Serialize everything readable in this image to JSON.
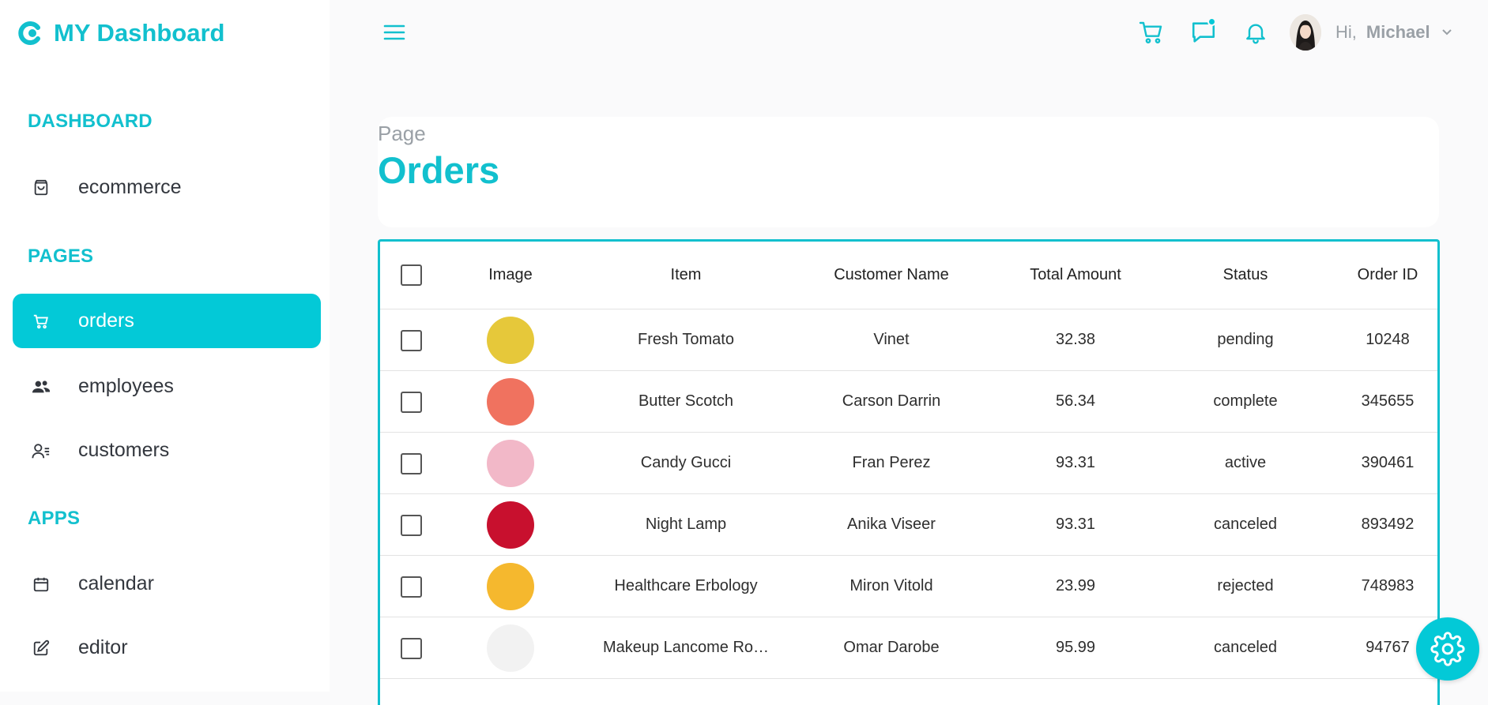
{
  "brand": {
    "name": "MY Dashboard",
    "color": "#12c0ce"
  },
  "sidebar": {
    "sections": [
      {
        "title": "DASHBOARD",
        "items": [
          {
            "label": "ecommerce",
            "icon": "shopping-bag-icon"
          }
        ]
      },
      {
        "title": "PAGES",
        "items": [
          {
            "label": "orders",
            "icon": "cart-icon",
            "active": true
          },
          {
            "label": "employees",
            "icon": "users-icon"
          },
          {
            "label": "customers",
            "icon": "customers-icon"
          }
        ]
      },
      {
        "title": "APPS",
        "items": [
          {
            "label": "calendar",
            "icon": "calendar-icon"
          },
          {
            "label": "editor",
            "icon": "edit-icon"
          }
        ]
      }
    ]
  },
  "header": {
    "greeting": "Hi,",
    "user_name": "Michael",
    "icons": [
      "cart-icon",
      "chat-icon",
      "bell-icon"
    ]
  },
  "page": {
    "subtitle": "Page",
    "title": "Orders"
  },
  "table": {
    "columns": [
      "Image",
      "Item",
      "Customer Name",
      "Total Amount",
      "Status",
      "Order ID"
    ],
    "rows": [
      {
        "item": "Fresh Tomato",
        "customer": "Vinet",
        "total": "32.38",
        "status": "pending",
        "order_id": "10248",
        "thumb_color": "#e6c83a"
      },
      {
        "item": "Butter Scotch",
        "customer": "Carson Darrin",
        "total": "56.34",
        "status": "complete",
        "order_id": "345655",
        "thumb_color": "#f0725f"
      },
      {
        "item": "Candy Gucci",
        "customer": "Fran Perez",
        "total": "93.31",
        "status": "active",
        "order_id": "390461",
        "thumb_color": "#f2b8c8"
      },
      {
        "item": "Night Lamp",
        "customer": "Anika Viseer",
        "total": "93.31",
        "status": "canceled",
        "order_id": "893492",
        "thumb_color": "#c8102e"
      },
      {
        "item": "Healthcare Erbology",
        "customer": "Miron Vitold",
        "total": "23.99",
        "status": "rejected",
        "order_id": "748983",
        "thumb_color": "#f5b82e"
      },
      {
        "item": "Makeup Lancome Ro…",
        "customer": "Omar Darobe",
        "total": "95.99",
        "status": "canceled",
        "order_id": "94767",
        "thumb_color": "#f2f2f2"
      }
    ]
  },
  "accent_color": "#03c9d7"
}
